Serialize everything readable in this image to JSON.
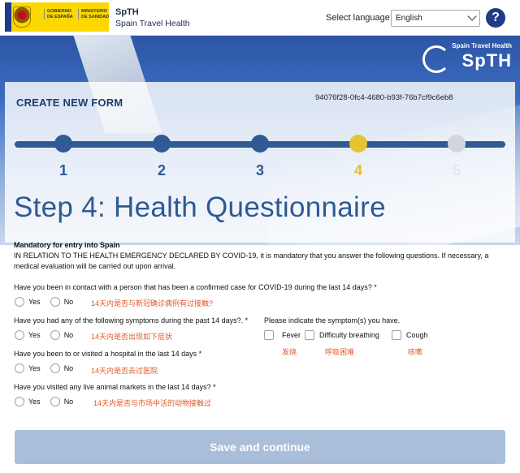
{
  "header": {
    "gov_line1": "GOBIERNO DE ESPAÑA",
    "gov_line2": "MINISTERIO DE SANIDAD",
    "brand_name": "SpTH",
    "brand_subtitle": "Spain Travel Health",
    "language_label": "Select language:",
    "language_value": "English",
    "help_label": "?"
  },
  "banner": {
    "logo_small": "Spain Travel Health",
    "logo_big": "SpTH"
  },
  "form": {
    "title": "CREATE NEW FORM",
    "form_id": "94076f28-0fc4-4680-b93f-76b7cf9c6eb8",
    "steps": [
      "1",
      "2",
      "3",
      "4",
      "5"
    ],
    "current_step": 4,
    "step_title": "Step 4: Health Questionnaire"
  },
  "questionnaire": {
    "mandatory_heading": "Mandatory for entry into Spain",
    "intro": "IN RELATION TO THE HEALTH EMERGENCY DECLARED BY COVID-19, it is mandatory that you answer the following questions. If necessary, a medical evaluation will be carried out upon arrival.",
    "yes_label": "Yes",
    "no_label": "No",
    "q1": {
      "label": "Have you been in contact with a person that has been a confirmed case for COVID-19 during the last 14 days? *",
      "cn": "14天内是否与新冠确诊病例有过接触?"
    },
    "q2": {
      "label": "Have you had any of the following symptoms during the past 14 days?. *",
      "cn": "14天内是否出现如下症状"
    },
    "symptoms_prompt": "Please indicate the symptom(s) you have.",
    "symptoms": [
      {
        "label": "Fever",
        "cn": "发烧"
      },
      {
        "label": "Difficulty breathing",
        "cn": "呼吸困难"
      },
      {
        "label": "Cough",
        "cn": "咳嗽"
      }
    ],
    "q3": {
      "label": "Have you been to or visited a hospital in the last 14 days *",
      "cn": "14天内是否去过医院"
    },
    "q4": {
      "label": "Have you visited any live animal markets in the last 14 days? *",
      "cn": "14天内是否与市场中活的动物接触过"
    }
  },
  "actions": {
    "save_label": "Save and continue"
  },
  "colors": {
    "primary": "#2f5a93",
    "current_step": "#e6c532",
    "future_step": "#d2d6dc",
    "chinese_text": "#e0572a",
    "save_button": "#a9bed9"
  }
}
